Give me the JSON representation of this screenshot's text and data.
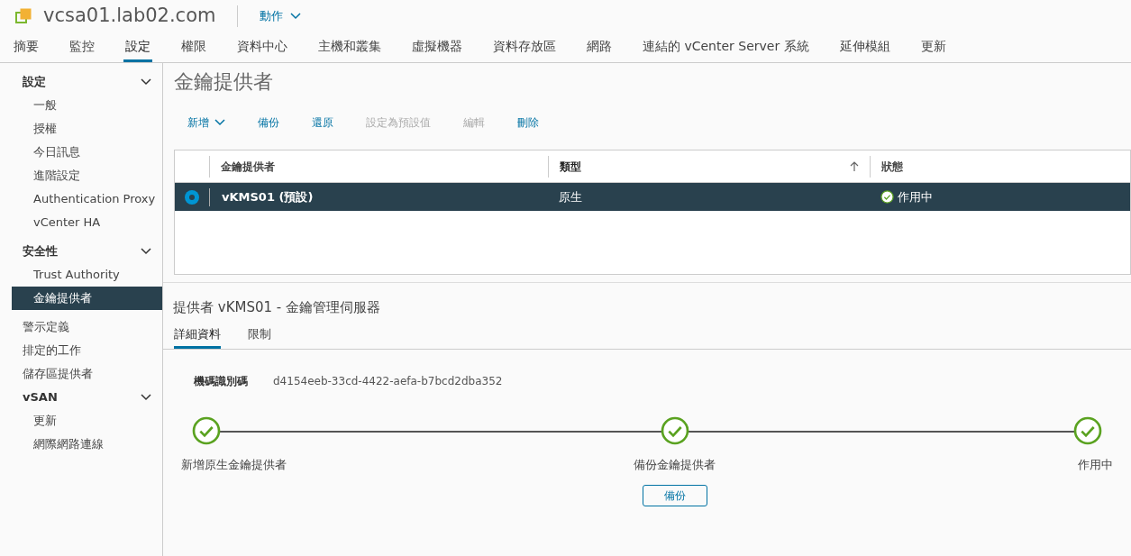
{
  "header": {
    "title": "vcsa01.lab02.com",
    "actions": "動作"
  },
  "tabs": [
    {
      "label": "摘要",
      "selected": false
    },
    {
      "label": "監控",
      "selected": false
    },
    {
      "label": "設定",
      "selected": true
    },
    {
      "label": "權限",
      "selected": false
    },
    {
      "label": "資料中心",
      "selected": false
    },
    {
      "label": "主機和叢集",
      "selected": false
    },
    {
      "label": "虛擬機器",
      "selected": false
    },
    {
      "label": "資料存放區",
      "selected": false
    },
    {
      "label": "網路",
      "selected": false
    },
    {
      "label": "連結的 vCenter Server 系統",
      "selected": false
    },
    {
      "label": "延伸模組",
      "selected": false
    },
    {
      "label": "更新",
      "selected": false
    }
  ],
  "sidebar": [
    {
      "kind": "group",
      "label": "設定",
      "expanded": true,
      "children": [
        {
          "label": "一般",
          "selected": false
        },
        {
          "label": "授權",
          "selected": false
        },
        {
          "label": "今日訊息",
          "selected": false
        },
        {
          "label": "進階設定",
          "selected": false
        },
        {
          "label": "Authentication Proxy",
          "selected": false
        },
        {
          "label": "vCenter HA",
          "selected": false
        }
      ]
    },
    {
      "kind": "group",
      "label": "安全性",
      "expanded": true,
      "children": [
        {
          "label": "Trust Authority",
          "selected": false
        },
        {
          "label": "金鑰提供者",
          "selected": true
        }
      ]
    },
    {
      "kind": "item",
      "label": "警示定義",
      "selected": false
    },
    {
      "kind": "item",
      "label": "排定的工作",
      "selected": false
    },
    {
      "kind": "item",
      "label": "儲存區提供者",
      "selected": false
    },
    {
      "kind": "group",
      "label": "vSAN",
      "expanded": true,
      "children": [
        {
          "label": "更新",
          "selected": false
        },
        {
          "label": "網際網路連線",
          "selected": false
        }
      ]
    }
  ],
  "page_title": "金鑰提供者",
  "toolbar": [
    {
      "label": "新增",
      "dropdown": true,
      "disabled": false
    },
    {
      "label": "備份",
      "dropdown": false,
      "disabled": false
    },
    {
      "label": "還原",
      "dropdown": false,
      "disabled": false
    },
    {
      "label": "設定為預設值",
      "dropdown": false,
      "disabled": true
    },
    {
      "label": "編輯",
      "dropdown": false,
      "disabled": true
    },
    {
      "label": "刪除",
      "dropdown": false,
      "disabled": false
    }
  ],
  "table": {
    "columns": [
      {
        "label": "金鑰提供者",
        "sorted": false
      },
      {
        "label": "類型",
        "sorted": true
      },
      {
        "label": "狀態",
        "sorted": false
      }
    ],
    "rows": [
      {
        "selected": true,
        "provider": "vKMS01 (預設)",
        "type": "原生",
        "status": "作用中"
      }
    ]
  },
  "detail": {
    "title": "提供者 vKMS01 - 金鑰管理伺服器",
    "tabs": [
      {
        "label": "詳細資料",
        "selected": true
      },
      {
        "label": "限制",
        "selected": false
      }
    ],
    "field": {
      "label": "機碼識別碼",
      "value": "d4154eeb-33cd-4422-aefa-b7bcd2dba352"
    },
    "steps": [
      {
        "label": "新增原生金鑰提供者",
        "done": true
      },
      {
        "label": "備份金鑰提供者",
        "done": true,
        "button": "備份"
      },
      {
        "label": "作用中",
        "done": true
      }
    ]
  }
}
